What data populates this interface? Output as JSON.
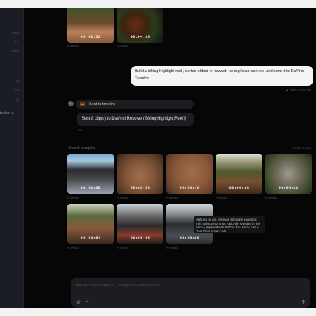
{
  "sidebar": {
    "items": [
      "now",
      "87",
      "now"
    ],
    "item_4": "4",
    "item_5": "2.5",
    "item_6": "3",
    "truncated_text": "to start a"
  },
  "top_thumbnails": [
    {
      "duration": "00:02:59",
      "name": "DJI5999"
    },
    {
      "duration": "00:04:29",
      "name": "DJI5999"
    }
  ],
  "user_message": {
    "text": "Build a biking highlight reel , sorted oldest to newest, no duplicate scenes, and send it to DaVinci Resolve",
    "meta": "Fable 4.5 ET PM"
  },
  "tool_call": {
    "icon_label": "dc",
    "label": "Sent to timeline"
  },
  "assistant_reply": {
    "text": "Sent 8 clip(s) to DaVinci Resolve ('Biking Highlight Reel')!",
    "meta": "1m"
  },
  "search": {
    "status": "Search complete",
    "count_note": "8 videos, 4 se"
  },
  "results": [
    {
      "duration": "00:01:35",
      "name": "DJI3000"
    },
    {
      "duration": "00:02:56",
      "name": "DJI5999"
    },
    {
      "duration": "00:03:40",
      "name": "DJI5000"
    },
    {
      "duration": "00:00:14",
      "name": "DJI5999"
    },
    {
      "duration": "00:04:12",
      "name": "DJI5999"
    },
    {
      "duration": "00:03:54",
      "name": "DJI3000"
    },
    {
      "duration": "00:06:05",
      "name": "DJI5999"
    },
    {
      "duration": "00:02:29",
      "name": "DJI5999"
    }
  ],
  "match_tooltip": "Matched in text retrieval, strongest evidence: This is long-shot shot. A bicycle is visible in the scene, captured with GoPro. The scene has a Dark Olive Green colo...",
  "composer": {
    "placeholder": "Ask about your videos - use @ to mention a face."
  },
  "colors": {
    "window_bg": "#070707",
    "sidebar_bg": "#1a1e24",
    "bubble_user": "#f4f4f4",
    "bubble_assistant": "#1b1d20",
    "accent_orange": "#f39b3b"
  }
}
